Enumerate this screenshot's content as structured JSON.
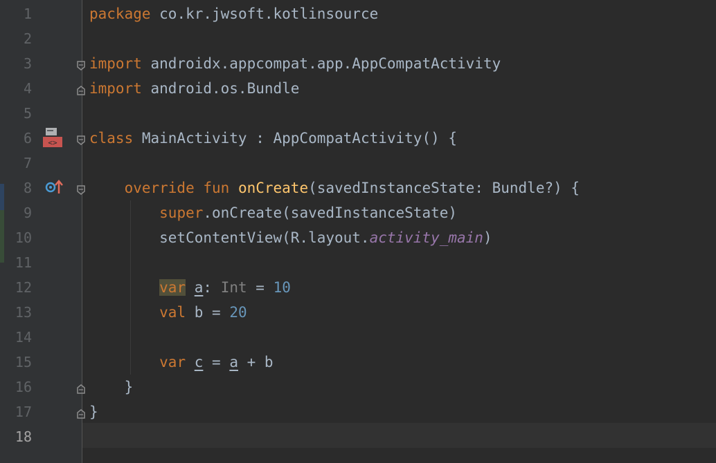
{
  "editor": {
    "current_line": 18,
    "line_numbers": [
      "1",
      "2",
      "3",
      "4",
      "5",
      "6",
      "7",
      "8",
      "9",
      "10",
      "11",
      "12",
      "13",
      "14",
      "15",
      "16",
      "17",
      "18"
    ],
    "lines": [
      [
        {
          "t": "package",
          "c": "kw"
        },
        {
          "t": " co.kr.jwsoft.kotlinsource"
        }
      ],
      [],
      [
        {
          "t": "import",
          "c": "kw"
        },
        {
          "t": " androidx.appcompat.app.AppCompatActivity"
        }
      ],
      [
        {
          "t": "import",
          "c": "kw"
        },
        {
          "t": " android.os.Bundle"
        }
      ],
      [],
      [
        {
          "t": "class",
          "c": "kw"
        },
        {
          "t": " MainActivity : AppCompatActivity() {"
        }
      ],
      [],
      [
        {
          "t": "    "
        },
        {
          "t": "override fun",
          "c": "kw"
        },
        {
          "t": " "
        },
        {
          "t": "onCreate",
          "c": "fn"
        },
        {
          "t": "(savedInstanceState: Bundle?) {"
        }
      ],
      [
        {
          "t": "        "
        },
        {
          "t": "super",
          "c": "kw"
        },
        {
          "t": ".onCreate(savedInstanceState)"
        }
      ],
      [
        {
          "t": "        setContentView(R.layout."
        },
        {
          "t": "activity_main",
          "c": "it"
        },
        {
          "t": ")"
        }
      ],
      [],
      [
        {
          "t": "        "
        },
        {
          "t": "var",
          "c": "kw hl"
        },
        {
          "t": " "
        },
        {
          "t": "a",
          "c": "ul"
        },
        {
          "t": ": "
        },
        {
          "t": "Int",
          "c": "gray"
        },
        {
          "t": " = "
        },
        {
          "t": "10",
          "c": "num"
        }
      ],
      [
        {
          "t": "        "
        },
        {
          "t": "val",
          "c": "kw"
        },
        {
          "t": " b = "
        },
        {
          "t": "20",
          "c": "num"
        }
      ],
      [],
      [
        {
          "t": "        "
        },
        {
          "t": "var",
          "c": "kw"
        },
        {
          "t": " "
        },
        {
          "t": "c",
          "c": "ul"
        },
        {
          "t": " = "
        },
        {
          "t": "a",
          "c": "ul"
        },
        {
          "t": " + b"
        }
      ],
      [
        {
          "t": "    }"
        }
      ],
      [
        {
          "t": "}"
        }
      ],
      []
    ]
  },
  "gutter_icons": [
    "layout-preview-icon",
    "override-method-icon"
  ],
  "fold_markers": [
    "fold-start-import-icon",
    "fold-end-import-icon",
    "fold-start-class-icon",
    "fold-start-oncreate-icon",
    "fold-end-oncreate-icon",
    "fold-end-class-icon"
  ],
  "colors": {
    "background": "#2b2b2b",
    "gutter": "#313335",
    "keyword": "#cc7832",
    "function": "#ffc66d",
    "number": "#6897bb",
    "field": "#9876aa",
    "text": "#a9b7c6"
  }
}
